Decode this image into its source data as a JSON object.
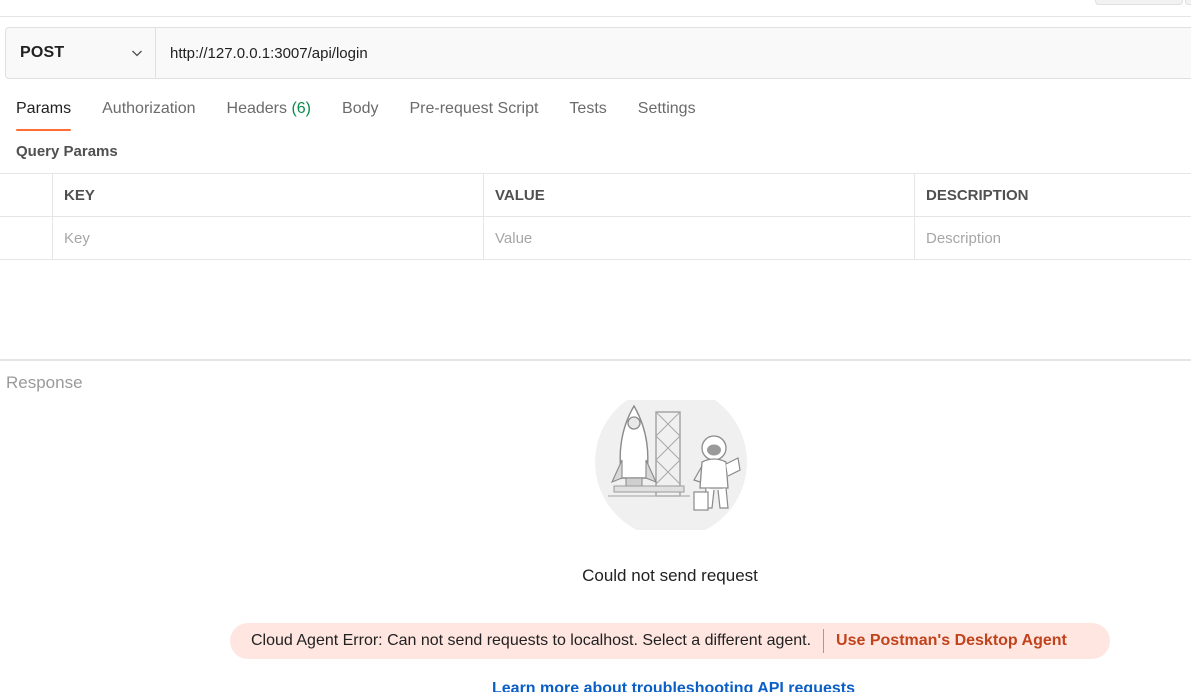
{
  "request": {
    "method": "POST",
    "url": "http://127.0.0.1:3007/api/login"
  },
  "tabs": [
    {
      "label": "Params",
      "active": true
    },
    {
      "label": "Authorization"
    },
    {
      "label": "Headers",
      "count": "(6)"
    },
    {
      "label": "Body"
    },
    {
      "label": "Pre-request Script"
    },
    {
      "label": "Tests"
    },
    {
      "label": "Settings"
    }
  ],
  "params": {
    "title": "Query Params",
    "columns": {
      "key": "KEY",
      "value": "VALUE",
      "description": "DESCRIPTION"
    },
    "placeholders": {
      "key": "Key",
      "value": "Value",
      "description": "Description"
    }
  },
  "response": {
    "label": "Response",
    "error_title": "Could not send request",
    "error_message": "Cloud Agent Error: Can not send requests to localhost. Select a different agent.",
    "agent_link": "Use Postman's Desktop Agent",
    "learn_link": "Learn more about troubleshooting API requests"
  },
  "colors": {
    "accent": "#ff6c37",
    "count_green": "#0b8a4a",
    "error_bg": "#ffe6e1",
    "error_link": "#c1431c",
    "link_blue": "#0a5fc7"
  },
  "icons": {
    "method_dropdown": "chevron-down-icon",
    "illustration": "rocket-astronaut-illustration"
  }
}
